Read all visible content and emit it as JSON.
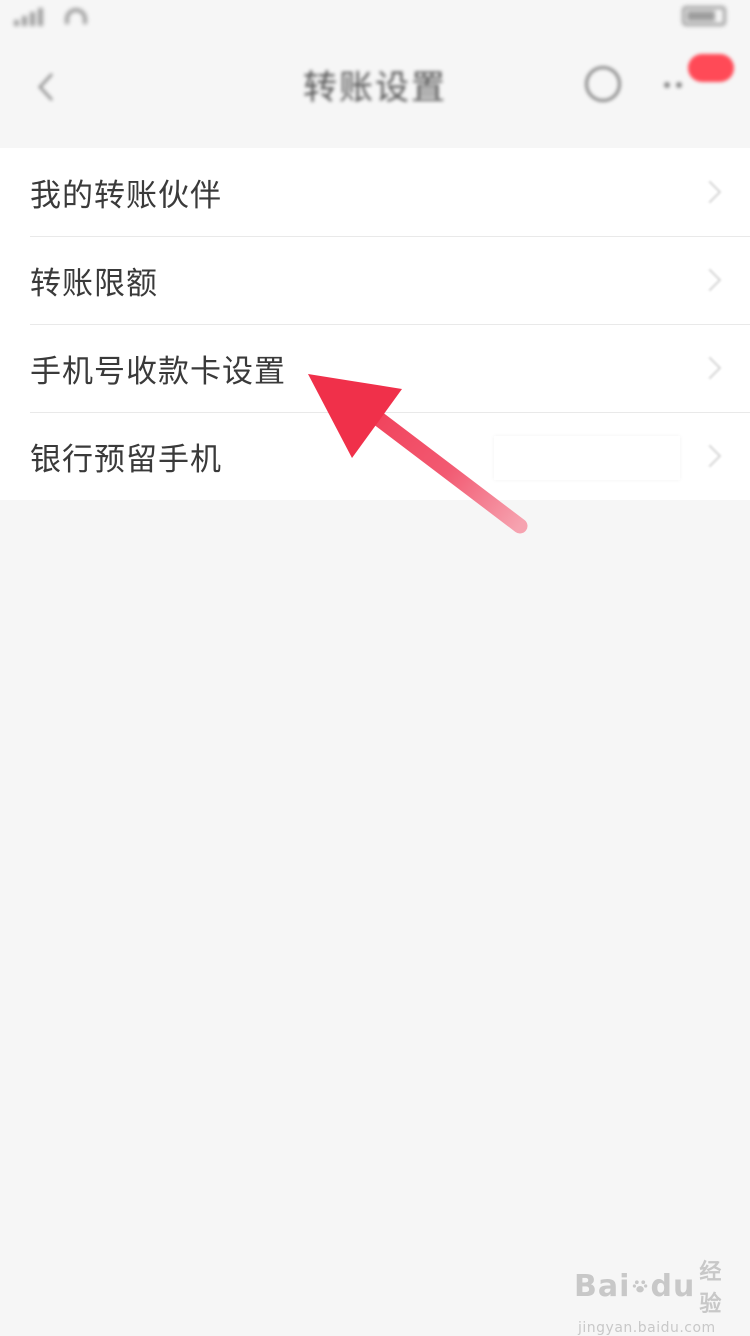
{
  "nav": {
    "title": "转账设置"
  },
  "menu": {
    "items": [
      {
        "label": "我的转账伙伴"
      },
      {
        "label": "转账限额"
      },
      {
        "label": "手机号收款卡设置"
      },
      {
        "label": "银行预留手机"
      }
    ]
  },
  "watermark": {
    "brand_left": "Bai",
    "brand_right": "du",
    "brand_cn": "经验",
    "url": "jingyan.baidu.com"
  },
  "colors": {
    "page_background": "#f6f6f6",
    "list_background": "#ffffff",
    "annotation_arrow": "#f0304a",
    "notification_badge": "#ff4a57"
  },
  "icons": {
    "back": "chevron-left-icon",
    "help": "help-circle-icon",
    "more": "more-dots-icon",
    "row_chevron": "chevron-right-icon",
    "watermark_paw": "paw-icon"
  }
}
